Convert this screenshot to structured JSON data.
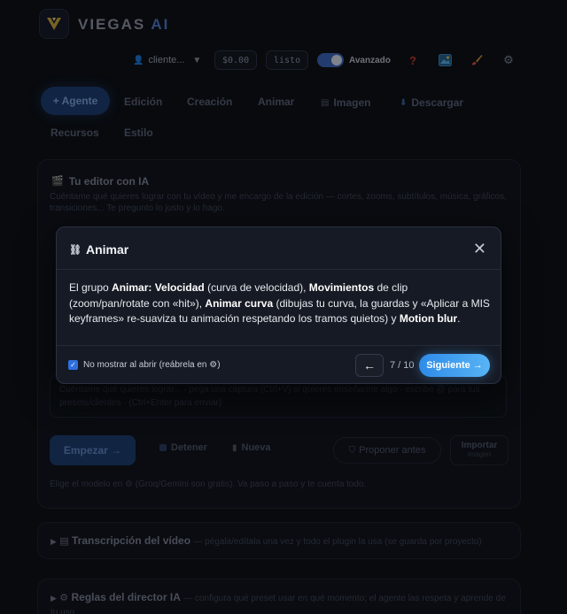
{
  "header": {
    "brand_main": "VIEGAS",
    "brand_accent": "AI",
    "client_label": "cliente...",
    "balance": "$0.00",
    "status": "listo",
    "advanced_label": "Avanzado",
    "icons": [
      "help-icon",
      "image-icon",
      "brush-icon",
      "gear-icon"
    ]
  },
  "tabs": [
    {
      "label": "+ Agente",
      "active": true
    },
    {
      "label": "Edición"
    },
    {
      "label": "Creación"
    },
    {
      "label": "Animar"
    },
    {
      "label": "Imagen",
      "icon": "document-icon"
    },
    {
      "label": "Descargar",
      "icon": "download-icon"
    },
    {
      "label": "Recursos"
    },
    {
      "label": "Estilo"
    }
  ],
  "editor": {
    "title": "Tu editor con IA",
    "description": "Cuéntame qué quieres lograr con tu vídeo y me encargo de la edición — cortes, zooms, subtítulos, música, gráficos, transiciones... Te pregunto lo justo y lo hago.",
    "input_placeholder": "Cuéntame qué quieres lograr... · pega una captura (Ctrl+V) si quieres enseñarme algo · escribe @ para tus presets/clientes · (Ctrl+Enter para enviar)",
    "start_label": "Empezar →",
    "stop_label": "Detener",
    "new_label": "Nueva",
    "propose_label": "Proponer antes",
    "import_label": "Importar",
    "import_sub": "imagen",
    "hint": "Elige el modelo en ⚙ (Groq/Gemini son gratis). Va paso a paso y te cuenta todo."
  },
  "sections": [
    {
      "title": "Transcripción del vídeo",
      "subtitle": "— pégala/edítala una vez y todo el plugin la usa (se guarda por proyecto)"
    },
    {
      "title": "Reglas del director IA",
      "subtitle": "— configura qué preset usar en qué momento; el agente las respeta y aprende de tu uso"
    }
  ],
  "modal": {
    "title": "Animar",
    "body_parts": [
      {
        "t": "El grupo "
      },
      {
        "t": "Animar: Velocidad",
        "b": true
      },
      {
        "t": " (curva de velocidad), "
      },
      {
        "t": "Movimientos",
        "b": true
      },
      {
        "t": " de clip (zoom/pan/rotate con «hit»), "
      },
      {
        "t": "Animar curva",
        "b": true
      },
      {
        "t": " (dibujas tu curva, la guardas y «Aplicar a MIS keyframes» re-suaviza tu animación respetando los tramos quietos) y "
      },
      {
        "t": "Motion blur",
        "b": true
      },
      {
        "t": "."
      }
    ],
    "dont_show_label": "No mostrar al abrir (reábrela en ⚙)",
    "dont_show_checked": true,
    "prev_label": "←",
    "step": "7 / 10",
    "next_label": "Siguiente →"
  }
}
